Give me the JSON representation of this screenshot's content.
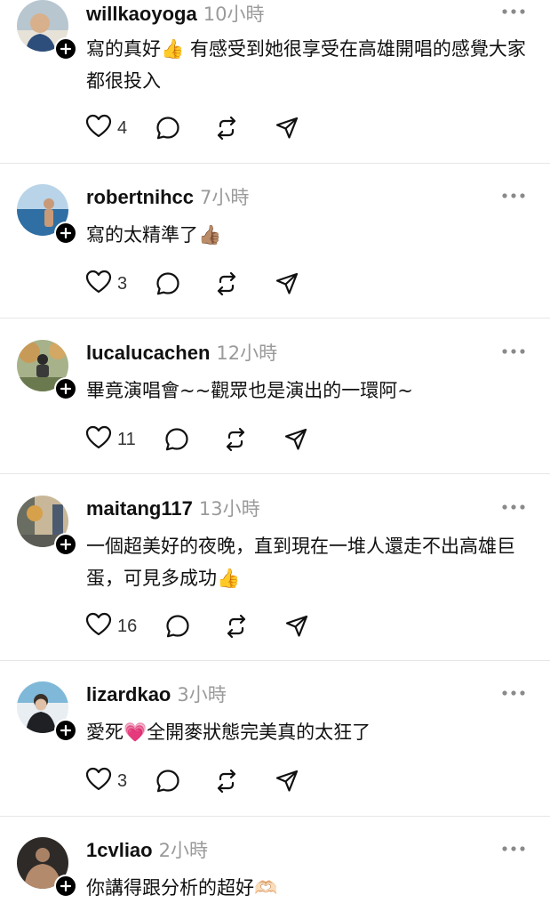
{
  "comments": [
    {
      "username": "willkaoyoga",
      "time": "10小時",
      "text": "寫的真好👍 有感受到她很享受在高雄開唱的感覺大家都很投入",
      "likes": "4",
      "avatar_colors": [
        "#9fb3c2",
        "#e7e2d8"
      ]
    },
    {
      "username": "robertnihcc",
      "time": "7小時",
      "text": "寫的太精準了👍🏽",
      "likes": "3",
      "avatar_colors": [
        "#3a7fb3",
        "#b9d4e8"
      ]
    },
    {
      "username": "lucalucachen",
      "time": "12小時",
      "text": "畢竟演唱會~~觀眾也是演出的一環阿~",
      "likes": "11",
      "avatar_colors": [
        "#7a8a5a",
        "#c89a58"
      ]
    },
    {
      "username": "maitang117",
      "time": "13小時",
      "text": "一個超美好的夜晚，直到現在一堆人還走不出高雄巨蛋，可見多成功👍",
      "likes": "16",
      "avatar_colors": [
        "#6a6e62",
        "#c9b79a"
      ]
    },
    {
      "username": "lizardkao",
      "time": "3小時",
      "text": "愛死💗全開麥狀態完美真的太狂了",
      "likes": "3",
      "avatar_colors": [
        "#5aa0c8",
        "#e8eef2"
      ]
    },
    {
      "username": "1cvliao",
      "time": "2小時",
      "text": "你講得跟分析的超好🫶🏻",
      "likes": "",
      "avatar_colors": [
        "#3b3430",
        "#a98266"
      ]
    }
  ],
  "icons": {
    "like": "heart-icon",
    "reply": "reply-bubble-icon",
    "repost": "repost-icon",
    "share": "share-send-icon",
    "more": "more-dots-icon",
    "follow": "follow-plus-icon"
  }
}
